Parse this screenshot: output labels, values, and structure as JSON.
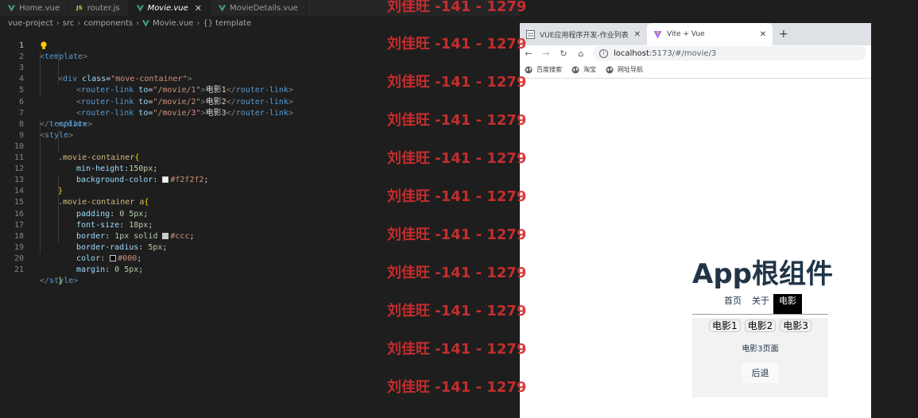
{
  "editor": {
    "tabs": [
      {
        "label": "Home.vue",
        "kind": "vue"
      },
      {
        "label": "router.js",
        "kind": "js"
      },
      {
        "label": "Movie.vue",
        "kind": "vue",
        "active": true
      },
      {
        "label": "MovieDetails.vue",
        "kind": "vue"
      }
    ],
    "breadcrumb": [
      "vue-project",
      "src",
      "components",
      "Movie.vue",
      "template"
    ],
    "line_numbers": [
      "1",
      "2",
      "3",
      "4",
      "5",
      "6",
      "7",
      "8",
      "9",
      "10",
      "11",
      "12",
      "13",
      "14",
      "15",
      "16",
      "17",
      "18",
      "19",
      "20",
      "21"
    ],
    "code": {
      "l1_tag": "template",
      "l2_tag": "div",
      "l2_attr": "class",
      "l2_val": "\"move-container\"",
      "l3_tag": "router-link",
      "l3_attr": "to",
      "l3_val": "\"/movie/1\"",
      "l3_text": "电影1",
      "l4_tag": "router-link",
      "l4_attr": "to",
      "l4_val": "\"/movie/2\"",
      "l4_text": "电影2",
      "l5_tag": "router-link",
      "l5_attr": "to",
      "l5_val": "\"/movie/3\"",
      "l5_text": "电影3",
      "l6_tag": "div",
      "l7_tag": "template",
      "l8_tag": "style",
      "l9_sel": ".movie-container",
      "l10_prop": "min-height",
      "l10_val": "150px",
      "l11_prop": "background-color",
      "l11_val": "#f2f2f2",
      "l13_sel": ".movie-container a",
      "l14_prop": "padding",
      "l14_val": "0 5px",
      "l15_prop": "font-size",
      "l15_val": "18px",
      "l16_prop": "border",
      "l16_val1": "1px solid",
      "l16_val2": "#ccc",
      "l17_prop": "border-radius",
      "l17_val": "5px",
      "l18_prop": "color",
      "l18_val": "#000",
      "l19_prop": "margin",
      "l19_val": "0 5px",
      "l21_tag": "style"
    },
    "swatch_colors": {
      "l11": "#f2f2f2",
      "l16": "#cccccc",
      "l18": "#000000"
    }
  },
  "watermark": "刘佳旺 -141 - 1279",
  "browser": {
    "tabs": [
      {
        "title": "VUE应用程序开发-作业列表",
        "active": false
      },
      {
        "title": "Vite + Vue",
        "active": true
      }
    ],
    "new_tab": "+",
    "url_host": "localhost",
    "url_path": ":5173/#/movie/3",
    "bookmarks": [
      "百度搜索",
      "淘宝",
      "网址导航"
    ],
    "page": {
      "title": "App根组件",
      "nav": [
        "首页",
        "关于",
        "电影"
      ],
      "active_nav": "电影",
      "movie_links": [
        "电影1",
        "电影2",
        "电影3"
      ],
      "movie_page_text": "电影3页面",
      "back_button": "后退"
    }
  },
  "colors": {
    "editor_bg": "#1e1e1e",
    "watermark": "#d42f2f",
    "vue_green": "#42b883",
    "app_title": "#213547",
    "movie_container_bg": "#f2f2f2"
  }
}
